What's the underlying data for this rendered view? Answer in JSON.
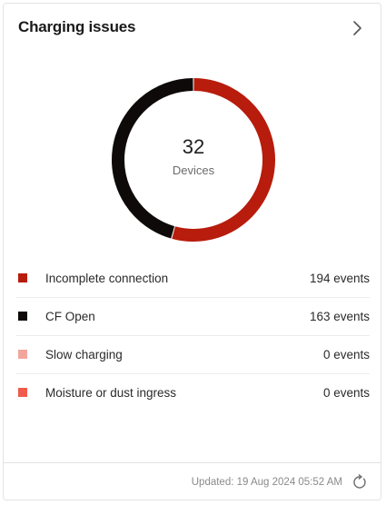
{
  "card": {
    "title": "Charging issues",
    "icons": {
      "more": "chevron-right-icon",
      "refresh": "refresh-icon"
    }
  },
  "chart_data": {
    "type": "pie",
    "donut": true,
    "center_value": "32",
    "center_label": "Devices",
    "series": [
      {
        "name": "Incomplete connection",
        "value": 194,
        "value_label": "194 events",
        "color": "#b71c0c"
      },
      {
        "name": "CF Open",
        "value": 163,
        "value_label": "163 events",
        "color": "#0f0a0a"
      },
      {
        "name": "Slow charging",
        "value": 0,
        "value_label": "0 events",
        "color": "#f2a69b"
      },
      {
        "name": "Moisture or dust ingress",
        "value": 0,
        "value_label": "0 events",
        "color": "#ef5b4c"
      }
    ]
  },
  "footer": {
    "updated": "Updated: 19 Aug 2024 05:52 AM"
  }
}
